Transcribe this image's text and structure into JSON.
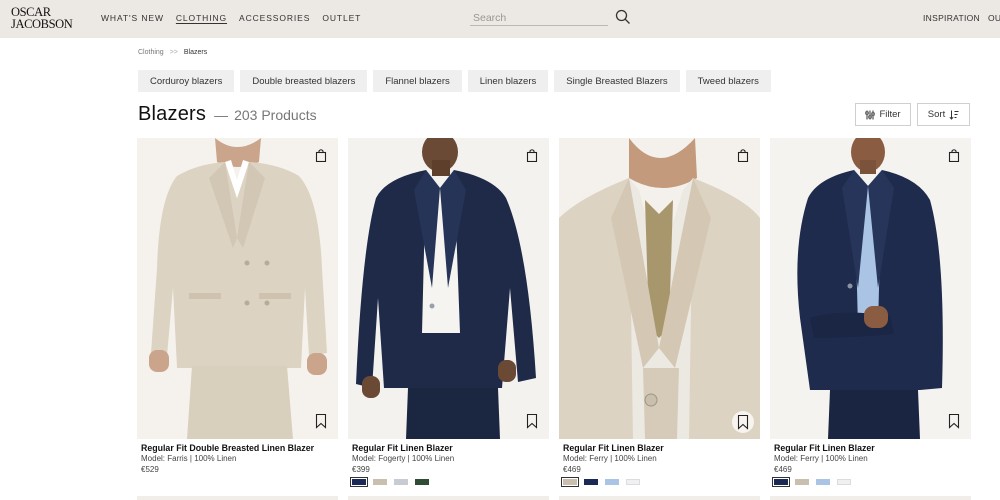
{
  "header": {
    "logo_line1": "OSCAR",
    "logo_line2": "JACOBSON",
    "nav": [
      "WHAT'S NEW",
      "CLOTHING",
      "ACCESSORIES",
      "OUTLET"
    ],
    "search_placeholder": "Search",
    "right_links": [
      "INSPIRATION",
      "OUR S"
    ]
  },
  "breadcrumb": {
    "items": [
      "Clothing",
      "Blazers"
    ],
    "separator": ">>"
  },
  "chips": [
    "Corduroy blazers",
    "Double breasted blazers",
    "Flannel blazers",
    "Linen blazers",
    "Single Breasted Blazers",
    "Tweed blazers"
  ],
  "listing": {
    "title": "Blazers",
    "dash": "—",
    "count": "203 Products",
    "filter_label": "Filter",
    "sort_label": "Sort"
  },
  "colors": {
    "header_bg": "#ece8e3",
    "chip_bg": "#efefef",
    "navy": "#1e2a47",
    "beige": "#ddd3c2"
  },
  "products": [
    {
      "name": "Regular Fit Double Breasted Linen Blazer",
      "model": "Model: Farris | 100% Linen",
      "price": "€529",
      "image": "beige-double-breasted-blazer",
      "swatches": []
    },
    {
      "name": "Regular Fit Linen Blazer",
      "model": "Model: Fogerty | 100% Linen",
      "price": "€399",
      "image": "navy-linen-blazer-white-shirt",
      "swatches": [
        "#1a2a55",
        "#c9bfae",
        "#c8ccd2",
        "#2f4d34"
      ]
    },
    {
      "name": "Regular Fit Linen Blazer",
      "model": "Model: Ferry | 100% Linen",
      "price": "€469",
      "image": "beige-linen-blazer-tie-closeup",
      "swatches": [
        "#c9bfae",
        "#1a2a55",
        "#a9c4e4",
        "#eef0f2"
      ]
    },
    {
      "name": "Regular Fit Linen Blazer",
      "model": "Model: Ferry | 100% Linen",
      "price": "€469",
      "image": "navy-linen-blazer-blue-shirt",
      "swatches": [
        "#1a2a55",
        "#c9bfae",
        "#a9c4e4",
        "#eef0f2"
      ]
    }
  ]
}
